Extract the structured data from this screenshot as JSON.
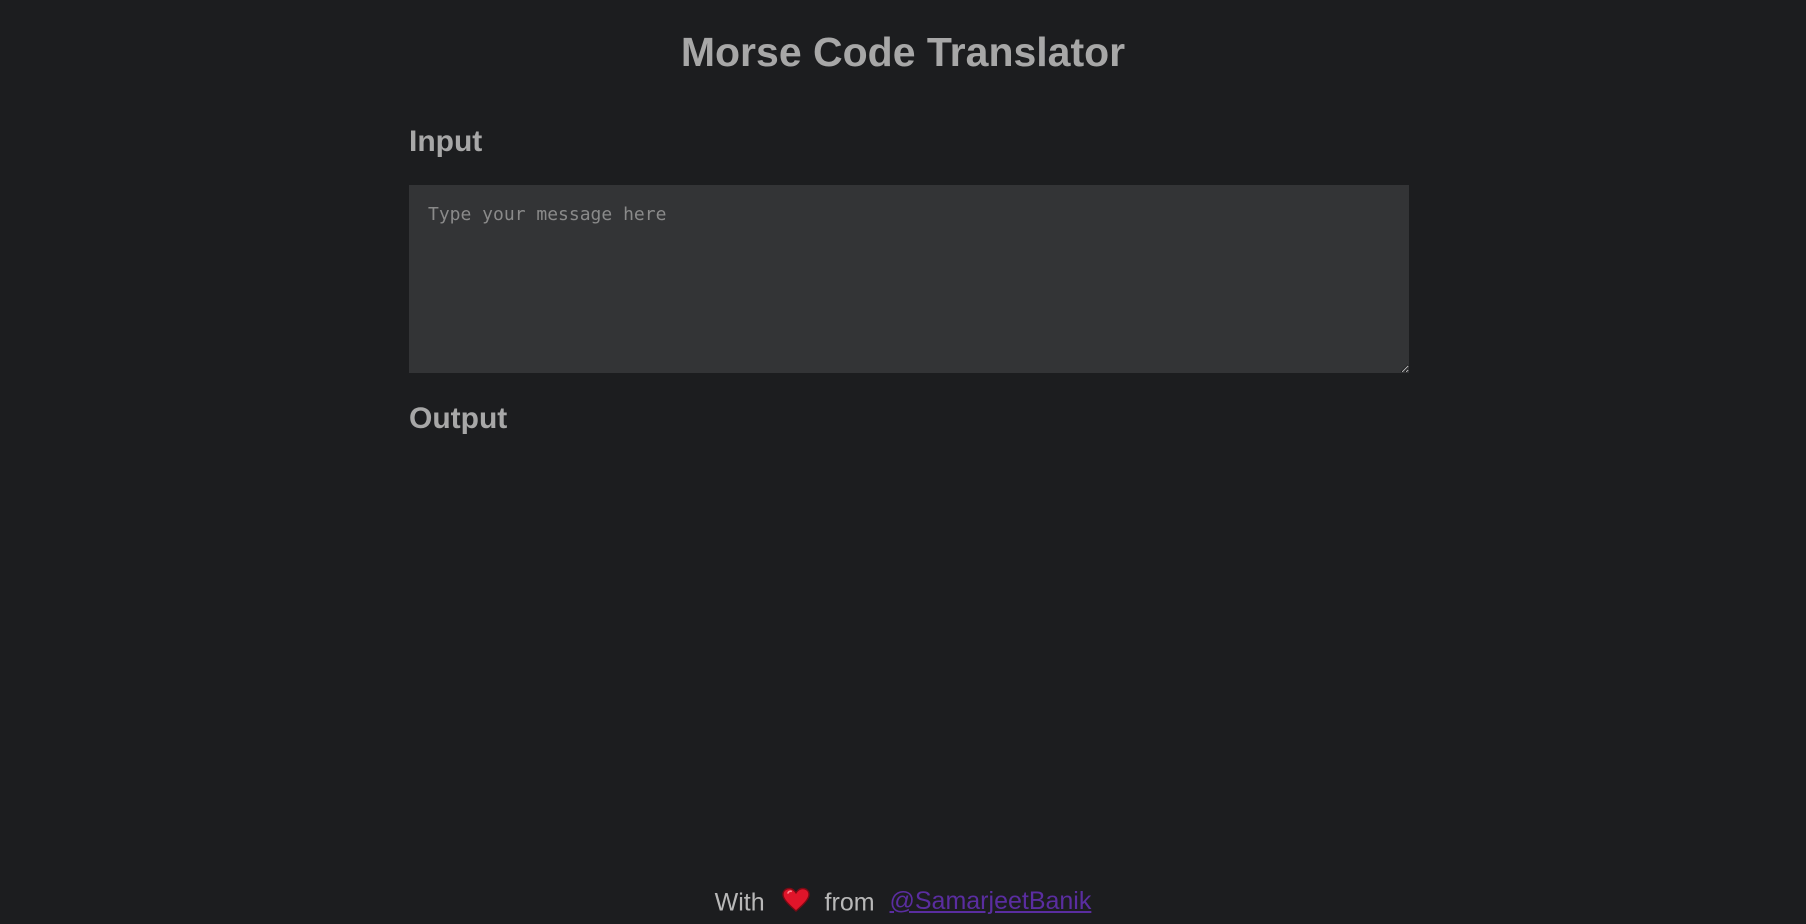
{
  "header": {
    "title": "Morse Code Translator"
  },
  "input": {
    "heading": "Input",
    "placeholder": "Type your message here",
    "value": ""
  },
  "output": {
    "heading": "Output",
    "value": ""
  },
  "footer": {
    "prefix": "With",
    "icon": "heart-icon",
    "middle": "from",
    "author_link": "@SamarjeetBanik"
  },
  "colors": {
    "background": "#1c1d1f",
    "text": "#a7a7a7",
    "input_background": "#333436",
    "link": "#5a2da0",
    "heart": "#e0152a"
  }
}
